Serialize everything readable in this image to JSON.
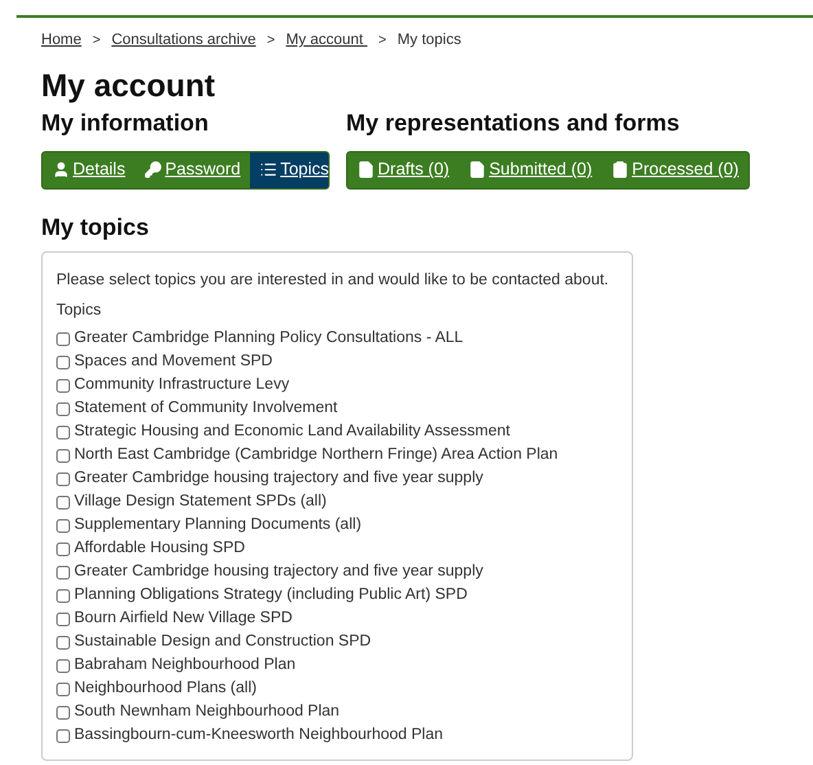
{
  "breadcrumb": [
    {
      "label": "Home",
      "kind": "link"
    },
    {
      "label": "Consultations archive",
      "kind": "link",
      "separator": ">"
    },
    {
      "label": "My account ",
      "kind": "link",
      "separator": ">"
    },
    {
      "label": "My topics",
      "kind": "current",
      "separator": ">"
    }
  ],
  "title": "My account",
  "info": {
    "heading": "My information",
    "tabs": [
      {
        "label": "Details",
        "selected": false
      },
      {
        "label": "Password",
        "selected": false
      },
      {
        "label": "Topics",
        "selected": true
      }
    ]
  },
  "forms": {
    "heading": "My representations and forms",
    "tabs": [
      {
        "label": "Drafts (0)",
        "selected": false
      },
      {
        "label": "Submitted (0)",
        "selected": false
      },
      {
        "label": "Processed (0)",
        "selected": false
      }
    ]
  },
  "topics_heading": "My topics",
  "intro": "Please select topics you are interested in and would like to be contacted about.",
  "topics_label": "Topics",
  "topics": [
    {
      "label": "Greater Cambridge Planning Policy Consultations - ALL",
      "checked": false
    },
    {
      "label": "Spaces and Movement SPD",
      "checked": false
    },
    {
      "label": "Community Infrastructure Levy",
      "checked": false
    },
    {
      "label": "Statement of Community Involvement",
      "checked": false
    },
    {
      "label": "Strategic Housing and Economic Land Availability Assessment",
      "checked": false
    },
    {
      "label": "North East Cambridge (Cambridge Northern Fringe) Area Action Plan",
      "checked": false
    },
    {
      "label": "Greater Cambridge housing trajectory and five year supply",
      "checked": false
    },
    {
      "label": "Village Design Statement SPDs (all)",
      "checked": false
    },
    {
      "label": "Supplementary Planning Documents (all)",
      "checked": false
    },
    {
      "label": "Affordable Housing SPD",
      "checked": false
    },
    {
      "label": "Greater Cambridge housing trajectory and five year supply",
      "checked": false
    },
    {
      "label": "Planning Obligations Strategy (including Public Art) SPD",
      "checked": false
    },
    {
      "label": "Bourn Airfield New Village SPD",
      "checked": false
    },
    {
      "label": "Sustainable Design and Construction SPD",
      "checked": false
    },
    {
      "label": "Babraham Neighbourhood Plan",
      "checked": false
    },
    {
      "label": "Neighbourhood Plans (all)",
      "checked": false
    },
    {
      "label": "South Newnham Neighbourhood Plan",
      "checked": false
    },
    {
      "label": "Bassingbourn-cum-Kneesworth Neighbourhood Plan",
      "checked": false
    }
  ]
}
